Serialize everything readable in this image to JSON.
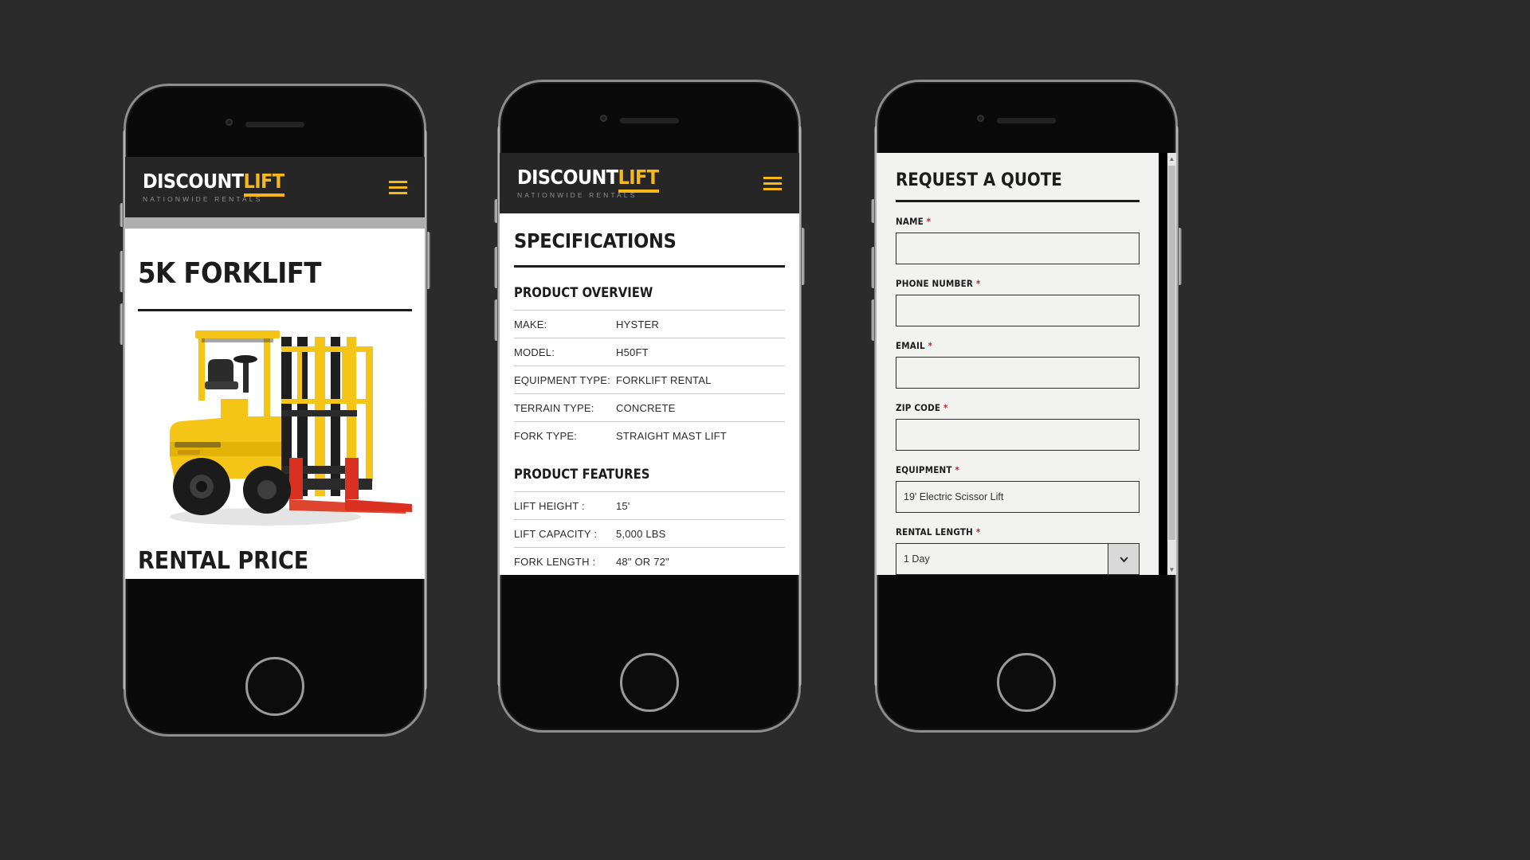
{
  "brand": {
    "logo_primary": "DISCOUNT",
    "logo_accent": "LIFT",
    "tagline": "NATIONWIDE RENTALS",
    "accent_color": "#f5b719",
    "header_bg": "#262626",
    "required_color": "#d02020"
  },
  "phone1": {
    "menu_icon": "hamburger-icon",
    "product_title": "5K FORKLIFT",
    "product_image_alt": "yellow-forklift-image",
    "next_section_title": "RENTAL PRICE"
  },
  "phone2": {
    "menu_icon": "hamburger-icon",
    "page_title": "SPECIFICATIONS",
    "sections": [
      {
        "heading": "PRODUCT OVERVIEW",
        "rows": [
          {
            "label": "MAKE:",
            "value": "HYSTER"
          },
          {
            "label": "MODEL:",
            "value": "H50FT"
          },
          {
            "label": "EQUIPMENT TYPE:",
            "value": "FORKLIFT RENTAL"
          },
          {
            "label": "TERRAIN TYPE:",
            "value": "CONCRETE"
          },
          {
            "label": "FORK TYPE:",
            "value": "STRAIGHT MAST LIFT"
          }
        ]
      },
      {
        "heading": "PRODUCT FEATURES",
        "rows": [
          {
            "label": "LIFT HEIGHT :",
            "value": "15'"
          },
          {
            "label": "LIFT CAPACITY :",
            "value": "5,000 LBS"
          },
          {
            "label": "FORK LENGTH :",
            "value": "48\" OR 72\""
          }
        ]
      }
    ]
  },
  "phone3": {
    "close_icon": "close-icon",
    "modal_title": "REQUEST A QUOTE",
    "fields": [
      {
        "label": "NAME",
        "required": "*",
        "value": "",
        "type": "text"
      },
      {
        "label": "PHONE NUMBER",
        "required": "*",
        "value": "",
        "type": "text"
      },
      {
        "label": "EMAIL",
        "required": "*",
        "value": "",
        "type": "text"
      },
      {
        "label": "ZIP CODE",
        "required": "*",
        "value": "",
        "type": "text"
      },
      {
        "label": "EQUIPMENT",
        "required": "*",
        "value": "19' Electric Scissor Lift",
        "type": "text"
      },
      {
        "label": "RENTAL LENGTH",
        "required": "*",
        "value": "1 Day",
        "type": "select"
      }
    ],
    "scroll_up_icon": "chevron-up-icon",
    "scroll_down_icon": "chevron-down-icon"
  }
}
